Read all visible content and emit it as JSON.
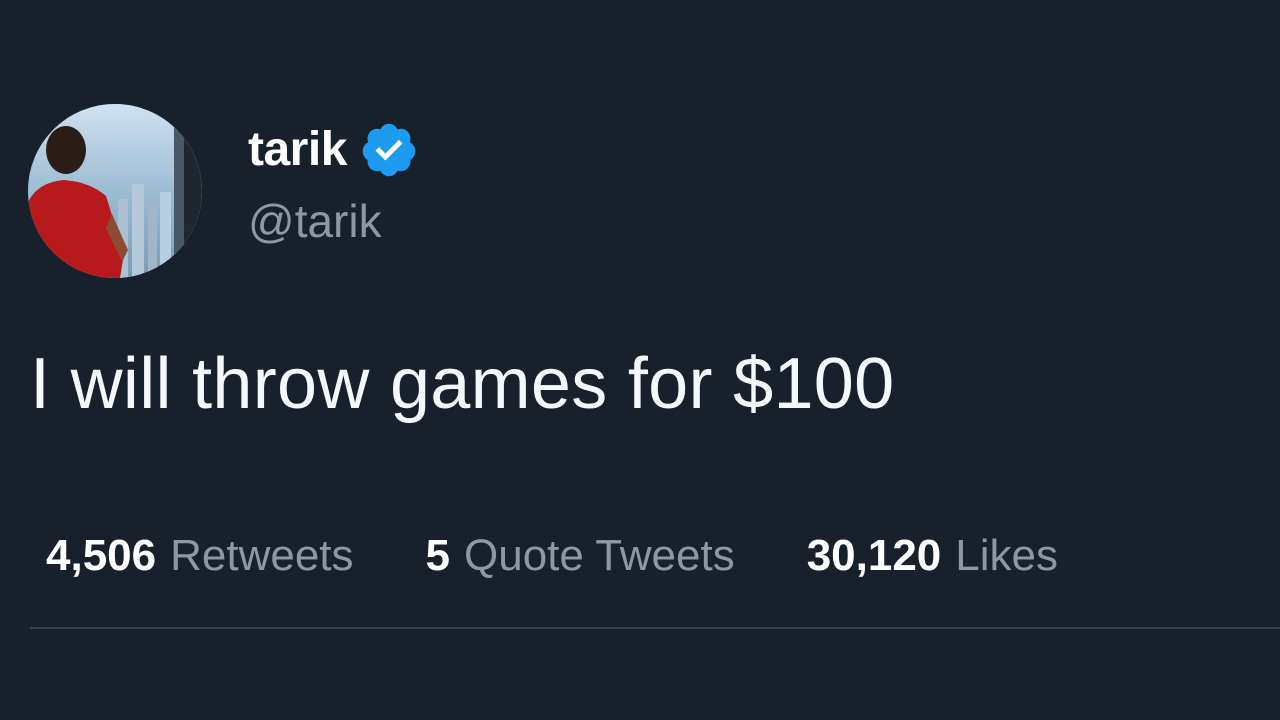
{
  "tweet": {
    "author": {
      "display_name": "tarik",
      "handle": "@tarik",
      "verified": true
    },
    "text": "I will throw games for $100",
    "stats": [
      {
        "count": "4,506",
        "label": "Retweets"
      },
      {
        "count": "5",
        "label": "Quote Tweets"
      },
      {
        "count": "30,120",
        "label": "Likes"
      }
    ]
  },
  "colors": {
    "background": "#17202b",
    "text_primary": "#ffffff",
    "text_secondary": "#8b98a5",
    "verified_badge": "#1d9bf0",
    "divider": "#38444d"
  }
}
